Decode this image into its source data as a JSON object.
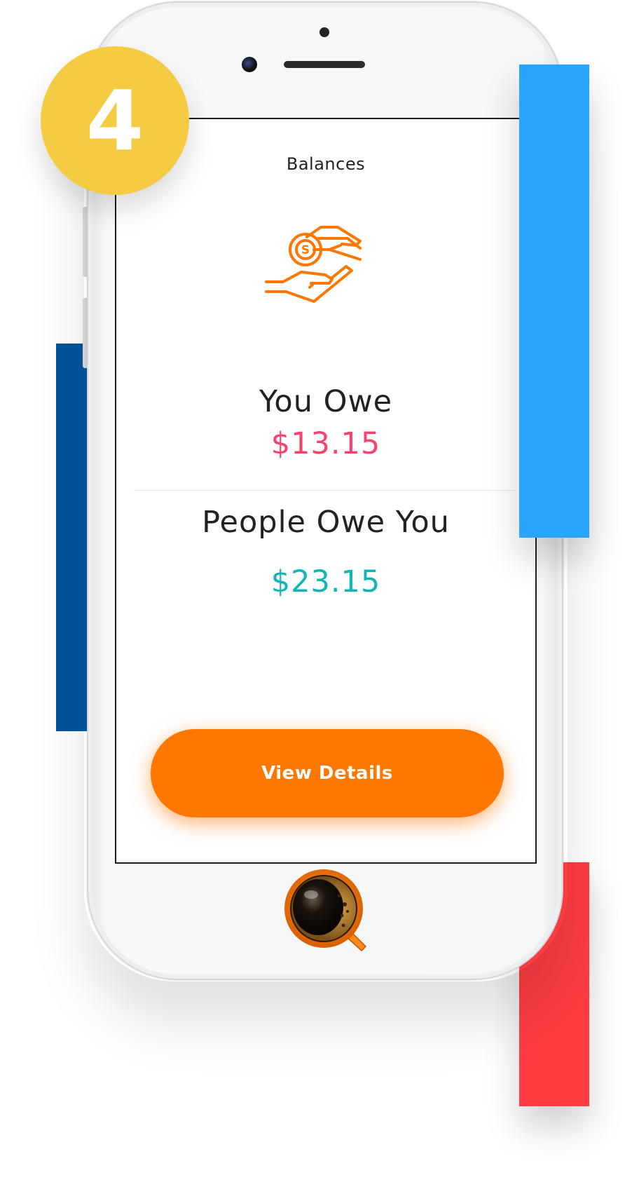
{
  "step_badge": {
    "number": "4"
  },
  "screen": {
    "title": "Balances",
    "icon": "hand-coin-icon",
    "you_owe": {
      "label": "You Owe",
      "amount": "$13.15"
    },
    "people_owe_you": {
      "label": "People Owe You",
      "amount": "$23.15"
    },
    "view_details_button": {
      "label": "View Details"
    }
  },
  "device": {
    "home_button_icon": "coffee-cup-icon"
  },
  "colors": {
    "accent_orange": "#fe7700",
    "owe_pink": "#f7426b",
    "owed_teal": "#11b5b5",
    "badge_yellow": "#f5cb44",
    "bar_dark_blue": "#00559c",
    "bar_light_blue": "#29a5fe",
    "bar_red": "#fd3d42"
  }
}
